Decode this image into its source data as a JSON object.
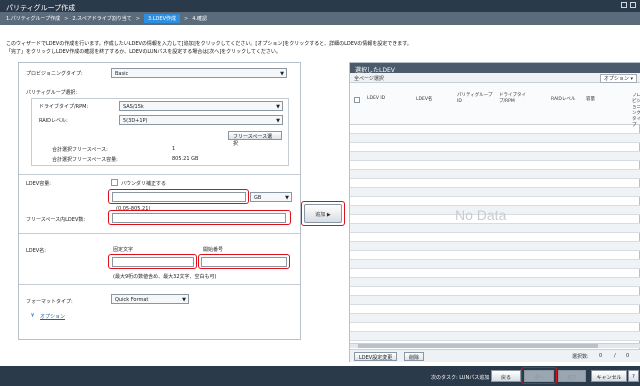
{
  "title": "パリティグループ作成",
  "wizard": {
    "steps": [
      "1.パリティグループ作成",
      "2.スペアドライブ割り当て",
      "3.LDEV作成",
      "4.確認"
    ],
    "separator": ">"
  },
  "instructions": [
    "このウィザードでLDEVの作成を行います。作成したいLDEVの情報を入力して[追加]をクリックしてください。[オプション]をクリックすると、詳細のLDEVの情報を設定できます。",
    "「完了」をクリックしLDEV作成の確認を終了するか、LDEVのLUNパスを設定する場合は[次へ]をクリックしてください。"
  ],
  "left": {
    "provisioning_label": "プロビジョニングタイプ:",
    "provisioning_value": "Basic",
    "pg_select_label": "パリティグループ選択:",
    "drive_label": "ドライブタイプ/RPM:",
    "drive_value": "SAS/15k",
    "raid_label": "RAIDレベル:",
    "raid_value": "5(3D+1P)",
    "free_space_button": "フリースペース選択",
    "total_free_label": "合計選択フリースペース:",
    "total_free_value": "1",
    "total_free_capacity_label": "合計選択フリースペース容量:",
    "total_free_capacity_value": "805.21 GB",
    "ldev_capacity_label": "LDEV容量:",
    "half_check_label": "バウンダリ補正する",
    "unit_value": "GB",
    "range_hint": "(0.05-805.21)",
    "free_space_ldev_label": "フリースペース内LDEV数:",
    "ldev_name_label": "LDEV名:",
    "fixed_char_label": "固定文字",
    "start_num_label": "開始番号",
    "name_hint": "(最大9桁の数値含め、最大32文字、空白も可)",
    "format_label": "フォーマットタイプ:",
    "format_value": "Quick Format",
    "options_link": "オプション",
    "options_icon": "double-chevron-down-icon"
  },
  "add_button": "追加 ▶",
  "right": {
    "header": "選択したLDEV",
    "select_all": "全ページ選択",
    "options": "オプション ▾",
    "columns": [
      "LDEV ID",
      "LDEV名",
      "パリティグループID",
      "ドライブタイプ/RPM",
      "RAIDレベル",
      "容量",
      "プロビジョニングタイプ"
    ],
    "no_data": "No Data",
    "change_button": "LDEV設定変更",
    "delete_button": "削除",
    "selected_label": "選択数:",
    "selected_count": "0",
    "slash": "/",
    "total_count": "0"
  },
  "footer": {
    "next_task": "次のタスク: LUNパス追加",
    "back": "戻る",
    "next": "次へ",
    "finish": "完了",
    "cancel": "キャンセル",
    "help": "?"
  }
}
